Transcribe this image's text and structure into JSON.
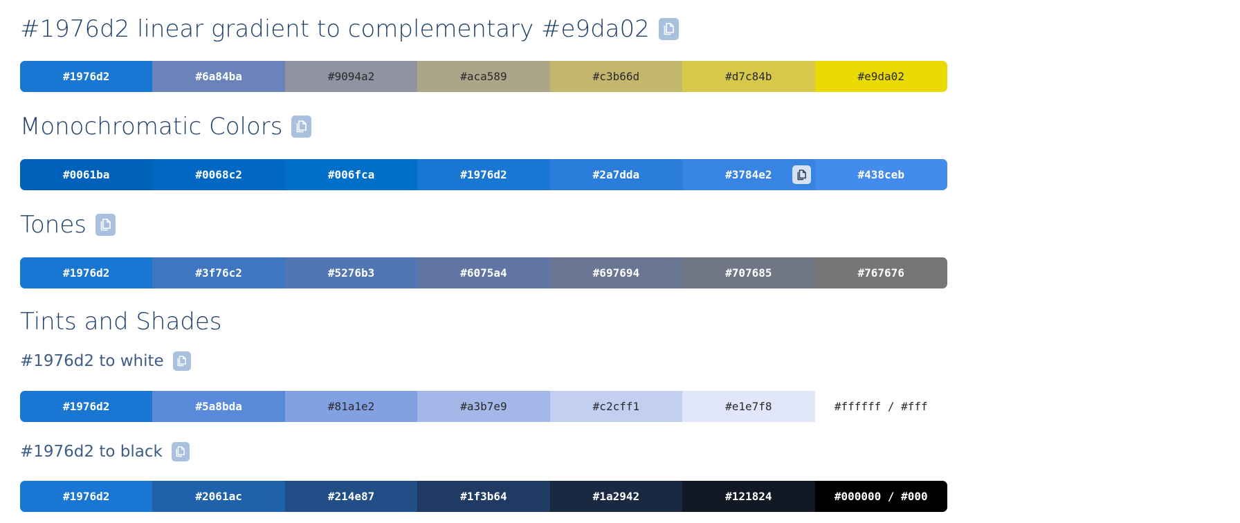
{
  "gradient": {
    "title": "#1976d2 linear gradient to complementary #e9da02",
    "swatches": [
      {
        "hex": "#1976d2",
        "label": "#1976d2",
        "text": "light"
      },
      {
        "hex": "#6a84ba",
        "label": "#6a84ba",
        "text": "light"
      },
      {
        "hex": "#9094a2",
        "label": "#9094a2",
        "text": "dark"
      },
      {
        "hex": "#aca589",
        "label": "#aca589",
        "text": "dark"
      },
      {
        "hex": "#c3b66d",
        "label": "#c3b66d",
        "text": "dark"
      },
      {
        "hex": "#d7c84b",
        "label": "#d7c84b",
        "text": "dark"
      },
      {
        "hex": "#e9da02",
        "label": "#e9da02",
        "text": "dark"
      }
    ]
  },
  "monochromatic": {
    "title": "Monochromatic Colors",
    "swatches": [
      {
        "hex": "#0061ba",
        "label": "#0061ba",
        "text": "light"
      },
      {
        "hex": "#0068c2",
        "label": "#0068c2",
        "text": "light"
      },
      {
        "hex": "#006fca",
        "label": "#006fca",
        "text": "light"
      },
      {
        "hex": "#1976d2",
        "label": "#1976d2",
        "text": "light"
      },
      {
        "hex": "#2a7dda",
        "label": "#2a7dda",
        "text": "light"
      },
      {
        "hex": "#3784e2",
        "label": "#3784e2",
        "text": "light",
        "copy_icon": true
      },
      {
        "hex": "#438ceb",
        "label": "#438ceb",
        "text": "light"
      }
    ]
  },
  "tones": {
    "title": "Tones",
    "swatches": [
      {
        "hex": "#1976d2",
        "label": "#1976d2",
        "text": "light"
      },
      {
        "hex": "#3f76c2",
        "label": "#3f76c2",
        "text": "light"
      },
      {
        "hex": "#5276b3",
        "label": "#5276b3",
        "text": "light"
      },
      {
        "hex": "#6075a4",
        "label": "#6075a4",
        "text": "light"
      },
      {
        "hex": "#697694",
        "label": "#697694",
        "text": "light"
      },
      {
        "hex": "#707685",
        "label": "#707685",
        "text": "light"
      },
      {
        "hex": "#767676",
        "label": "#767676",
        "text": "light"
      }
    ]
  },
  "tints_shades": {
    "title": "Tints and Shades",
    "to_white": {
      "title": "#1976d2 to white",
      "swatches": [
        {
          "hex": "#1976d2",
          "label": "#1976d2",
          "text": "light"
        },
        {
          "hex": "#5a8bda",
          "label": "#5a8bda",
          "text": "light"
        },
        {
          "hex": "#81a1e2",
          "label": "#81a1e2",
          "text": "dark"
        },
        {
          "hex": "#a3b7e9",
          "label": "#a3b7e9",
          "text": "dark"
        },
        {
          "hex": "#c2cff1",
          "label": "#c2cff1",
          "text": "dark"
        },
        {
          "hex": "#e1e7f8",
          "label": "#e1e7f8",
          "text": "dark"
        },
        {
          "hex": "#ffffff",
          "label": "#ffffff / #fff",
          "text": "dark"
        }
      ]
    },
    "to_black": {
      "title": "#1976d2 to black",
      "swatches": [
        {
          "hex": "#1976d2",
          "label": "#1976d2",
          "text": "light"
        },
        {
          "hex": "#2061ac",
          "label": "#2061ac",
          "text": "light"
        },
        {
          "hex": "#214e87",
          "label": "#214e87",
          "text": "light"
        },
        {
          "hex": "#1f3b64",
          "label": "#1f3b64",
          "text": "light"
        },
        {
          "hex": "#1a2942",
          "label": "#1a2942",
          "text": "light"
        },
        {
          "hex": "#121824",
          "label": "#121824",
          "text": "light"
        },
        {
          "hex": "#000000",
          "label": "#000000 / #000",
          "text": "light"
        }
      ]
    }
  },
  "icons": {
    "copy": "copy-icon"
  },
  "colors": {
    "heading": "#1e3f6a",
    "copy_button_bg": "#a9c1de"
  }
}
